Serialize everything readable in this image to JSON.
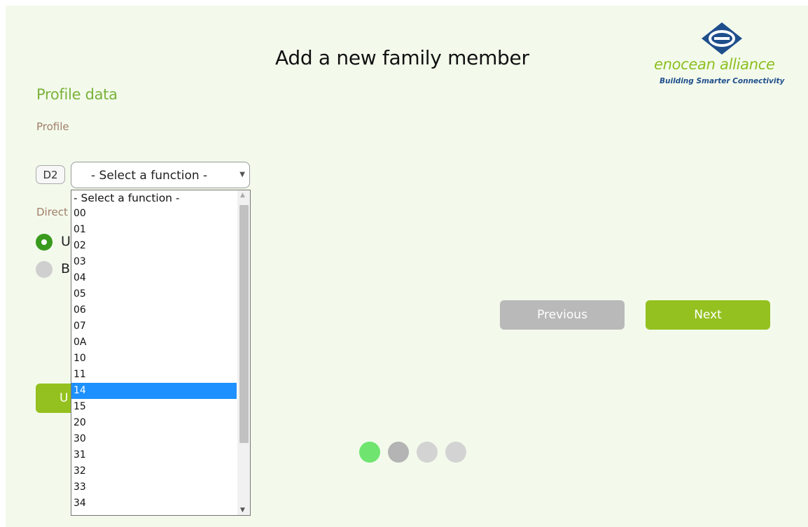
{
  "page": {
    "title": "Add a new family member"
  },
  "logo": {
    "name": "enocean alliance",
    "tagline": "Building Smarter Connectivity",
    "brand_blue": "#1f4e8c",
    "brand_green": "#8cbf1f"
  },
  "form": {
    "section_title": "Profile data",
    "profile_label": "Profile",
    "profile_prefix": "D2",
    "function_select": {
      "selected": "- Select a function -",
      "options": [
        "- Select a function -",
        "00",
        "01",
        "02",
        "03",
        "04",
        "05",
        "06",
        "07",
        "0A",
        "10",
        "11",
        "14",
        "15",
        "20",
        "30",
        "31",
        "32",
        "33",
        "34"
      ],
      "highlighted": "14"
    },
    "direction_label": "Direct",
    "radio_options": [
      {
        "label": "U",
        "checked": true
      },
      {
        "label": "B",
        "checked": false
      }
    ],
    "upload_label": "U"
  },
  "nav": {
    "previous_label": "Previous",
    "next_label": "Next"
  },
  "progress": {
    "steps": 4,
    "current": 1
  },
  "colors": {
    "accent_green": "#94c11f",
    "heading_green": "#7ab23a",
    "label_brown": "#a07d67",
    "disabled_gray": "#b9b9b9"
  }
}
